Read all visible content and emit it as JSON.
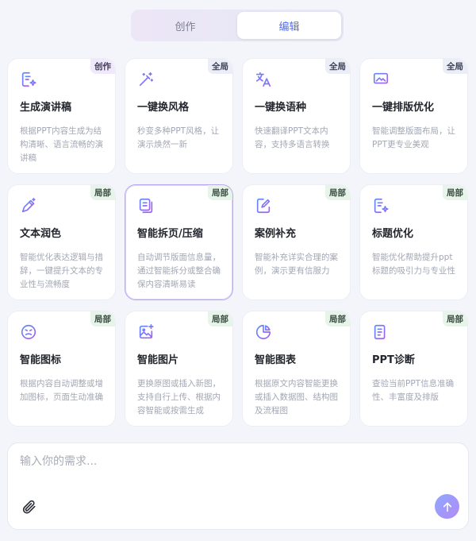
{
  "tabs": [
    {
      "label": "创作",
      "active": false
    },
    {
      "label": "编辑",
      "active": true
    }
  ],
  "cards": [
    {
      "title": "生成演讲稿",
      "badge": "创作",
      "badge_type": "create",
      "icon": "document-sparkle-icon",
      "desc": "根据PPT内容生成为结构清晰、语言流畅的演讲稿"
    },
    {
      "title": "一键换风格",
      "badge": "全局",
      "badge_type": "global",
      "icon": "magic-wand-icon",
      "desc": "秒变多种PPT风格，让演示焕然一新"
    },
    {
      "title": "一键换语种",
      "badge": "全局",
      "badge_type": "global",
      "icon": "translate-icon",
      "desc": "快速翻译PPT文本内容，支持多语言转换"
    },
    {
      "title": "一键排版优化",
      "badge": "全局",
      "badge_type": "global",
      "icon": "layout-image-icon",
      "desc": "智能调整版面布局，让PPT更专业美观"
    },
    {
      "title": "文本润色",
      "badge": "局部",
      "badge_type": "local",
      "icon": "pen-sparkle-icon",
      "desc": "智能优化表达逻辑与措辞，一键提升文本的专业性与流畅度"
    },
    {
      "title": "智能拆页/压缩",
      "badge": "局部",
      "badge_type": "local",
      "icon": "split-pages-icon",
      "desc": "自动调节版面信息量，通过智能拆分或整合确保内容清晰易读"
    },
    {
      "title": "案例补充",
      "badge": "局部",
      "badge_type": "local",
      "icon": "edit-document-icon",
      "desc": "智能补充详实合理的案例，演示更有信服力"
    },
    {
      "title": "标题优化",
      "badge": "局部",
      "badge_type": "local",
      "icon": "title-sparkle-icon",
      "desc": "智能优化帮助提升ppt标题的吸引力与专业性"
    },
    {
      "title": "智能图标",
      "badge": "局部",
      "badge_type": "local",
      "icon": "emoji-face-icon",
      "desc": "根据内容自动调整或增加图标，页面生动准确"
    },
    {
      "title": "智能图片",
      "badge": "局部",
      "badge_type": "local",
      "icon": "image-sparkle-icon",
      "desc": "更换原图或插入新图，支持自行上传、根据内容智能或按需生成"
    },
    {
      "title": "智能图表",
      "badge": "局部",
      "badge_type": "local",
      "icon": "pie-chart-icon",
      "desc": "根据原文内容智能更换或插入数据图、结构图及流程图"
    },
    {
      "title": "PPT诊断",
      "badge": "局部",
      "badge_type": "local",
      "icon": "diagnosis-document-icon",
      "desc": "查验当前PPT信息准确性、丰富度及排版"
    }
  ],
  "input": {
    "placeholder": "输入你的需求...",
    "value": ""
  },
  "icons": {
    "attach": "paperclip-icon",
    "send": "arrow-up-icon"
  },
  "colors": {
    "accent": "#4f6df2",
    "icon_start": "#5b8cff",
    "icon_end": "#a65cf2"
  }
}
